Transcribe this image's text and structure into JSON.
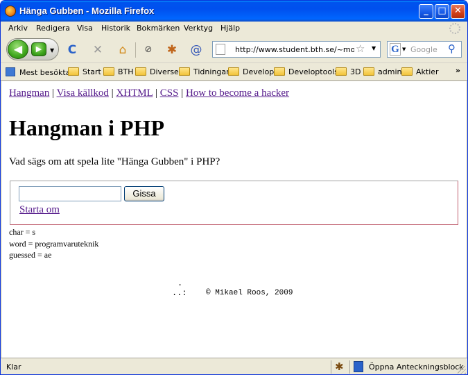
{
  "window": {
    "title": "Hänga Gubben - Mozilla Firefox",
    "buttons": {
      "minimize": "_",
      "maximize": "□",
      "close": "✕"
    }
  },
  "menubar": {
    "items": [
      "Arkiv",
      "Redigera",
      "Visa",
      "Historik",
      "Bokmärken",
      "Verktyg",
      "Hjälp"
    ]
  },
  "navbar": {
    "back_icon": "◀",
    "forward_icon": "▶",
    "reload_icon": "C",
    "stop_icon": "✕",
    "home_icon": "⌂",
    "url": "http://www.student.bth.se/~mos/d",
    "search_placeholder": "Google",
    "icons": [
      "back-icon",
      "forward-icon",
      "reload-icon",
      "stop-icon",
      "home-icon",
      "extension-icon",
      "firebug-icon",
      "spiral-icon",
      "page-icon",
      "bookmark-star-icon",
      "google-icon",
      "search-icon"
    ]
  },
  "bookmarks": {
    "items": [
      "Mest besökta",
      "Start",
      "BTH",
      "Diverse",
      "Tidningar",
      "Develop",
      "Developtools",
      "3D",
      "admin",
      "Aktier"
    ],
    "more": "»"
  },
  "page": {
    "nav_links": [
      "Hangman",
      "Visa källkod",
      "XHTML",
      "CSS",
      "How to become a hacker"
    ],
    "separator": "|",
    "heading": "Hangman i PHP",
    "intro": "Vad sägs om att spela lite \"Hänga Gubben\" i PHP?",
    "form": {
      "input_value": "",
      "submit_label": "Gissa",
      "restart_link": "Starta om"
    },
    "debug": {
      "char": "char = s",
      "word": "word = programvaruteknik",
      "guessed": "guessed = ae"
    },
    "footer": {
      "art_line1": ".",
      "art_line2": "..:",
      "copyright": "© Mikael Roos, 2009"
    }
  },
  "statusbar": {
    "text": "Klar",
    "notes_label": "Öppna Anteckningsblock"
  }
}
